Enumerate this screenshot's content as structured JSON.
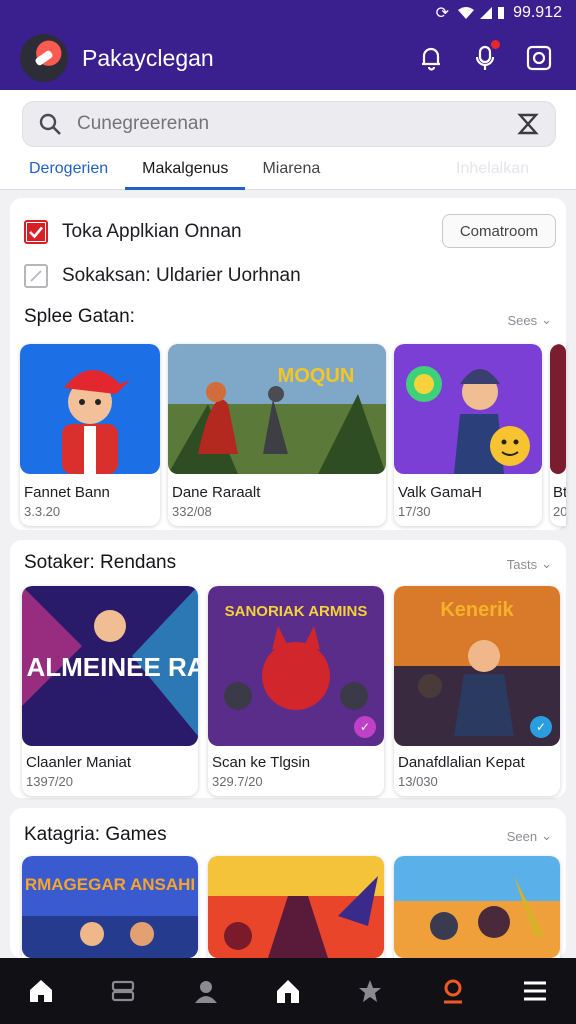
{
  "status": {
    "time": "99.912"
  },
  "appbar": {
    "title": "Pakayclegan"
  },
  "search": {
    "placeholder": "Cunegreerenan"
  },
  "tabs": [
    {
      "label": "Derogerien"
    },
    {
      "label": "Makalgenus"
    },
    {
      "label": "Miarena"
    },
    {
      "label": "Inhelalkan"
    }
  ],
  "filters": [
    {
      "label": "Toka Applkian Onnan",
      "checked": true
    },
    {
      "label": "Sokaksan: Uldarier Uorhnan",
      "checked": false
    }
  ],
  "main_button": {
    "label": "Comatroom"
  },
  "sections": [
    {
      "title": "Splee Gatan:",
      "see": "Sees",
      "items": [
        {
          "name": "Fannet Bann",
          "meta": "3.3.20"
        },
        {
          "name": "Dane Raraalt",
          "meta": "332/08"
        },
        {
          "name": "Valk GamaH",
          "meta": "17/30"
        },
        {
          "name": "Btu",
          "meta": "20"
        }
      ]
    },
    {
      "title": "Sotaker: Rendans",
      "see": "Tasts",
      "items": [
        {
          "name": "Claanler Maniat",
          "meta": "1397/20",
          "art": "DIBIBI ALMEINEE RALBAN"
        },
        {
          "name": "Scan ke Tlgsin",
          "meta": "329.7/20",
          "art": "SANORIAK ARMINS"
        },
        {
          "name": "Danafdlalian Kepat",
          "meta": "13/030",
          "art": "Kenerik"
        }
      ]
    },
    {
      "title": "Katagria: Games",
      "see": "Seen",
      "items": [
        {
          "name": "",
          "meta": "",
          "art": "RMAGEGAR ANSAHI"
        },
        {
          "name": "",
          "meta": ""
        },
        {
          "name": "",
          "meta": ""
        }
      ]
    }
  ],
  "thumb_art": {
    "moqun": "MOQUN"
  },
  "bottom_nav": [
    {
      "icon": "home-icon"
    },
    {
      "icon": "library-icon"
    },
    {
      "icon": "profile-icon"
    },
    {
      "icon": "house-icon"
    },
    {
      "icon": "favorites-icon"
    },
    {
      "icon": "location-icon"
    },
    {
      "icon": "menu-icon"
    }
  ],
  "colors": {
    "brand": "#3a1f8f",
    "accent": "#2061c4",
    "checked": "#d91f26"
  }
}
